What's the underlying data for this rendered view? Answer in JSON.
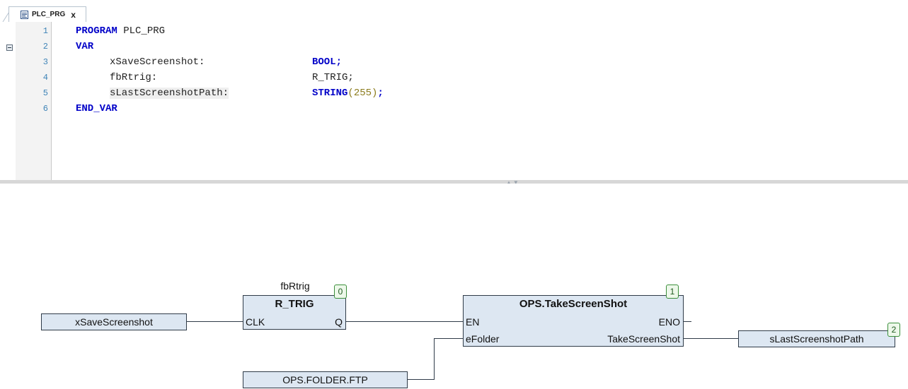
{
  "tab": {
    "title": "PLC_PRG",
    "close": "x"
  },
  "declaration": {
    "line_numbers": [
      "1",
      "2",
      "3",
      "4",
      "5",
      "6"
    ],
    "lines": [
      {
        "keyword": "PROGRAM",
        "rest": " PLC_PRG"
      },
      {
        "keyword": "VAR"
      },
      {
        "name": "xSaveScreenshot:",
        "type": "BOOL",
        "suffix": ";"
      },
      {
        "name": "fbRtrig:",
        "type": "R_TRIG",
        "suffix": ";"
      },
      {
        "name": "sLastScreenshotPath:",
        "type": "STRING",
        "arg": "(255)",
        "suffix": ";"
      },
      {
        "keyword": "END_VAR"
      }
    ]
  },
  "cfc": {
    "input_var": "xSaveScreenshot",
    "folder_const": "OPS.FOLDER.FTP",
    "fb_rtrig": {
      "instance": "fbRtrig",
      "type": "R_TRIG",
      "pin_in": "CLK",
      "pin_out": "Q",
      "order": "0"
    },
    "fb_screenshot": {
      "type": "OPS.TakeScreenShot",
      "pin_en": "EN",
      "pin_eno": "ENO",
      "pin_folder": "eFolder",
      "pin_out": "TakeScreenShot",
      "order": "1"
    },
    "output_var": {
      "name": "sLastScreenshotPath",
      "order": "2"
    }
  }
}
